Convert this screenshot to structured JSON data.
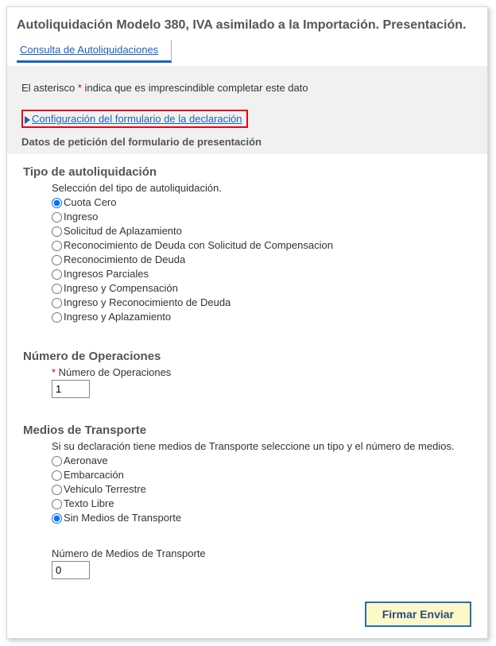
{
  "header": {
    "title": "Autoliquidación Modelo 380, IVA asimilado a la Importación. Presentación."
  },
  "tabs": {
    "consulta": "Consulta de Autoliquidaciones"
  },
  "notes": {
    "required_prefix": "El asterisco ",
    "required_mark": "*",
    "required_suffix": " indica que es imprescindible completar este dato"
  },
  "config_link": "Configuración del formulario de la declaración",
  "section_title": "Datos de petición del formulario de presentación",
  "autoliq": {
    "heading": "Tipo de autoliquidación",
    "helper": "Selección del tipo de autoliquidación.",
    "options": [
      "Cuota Cero",
      "Ingreso",
      "Solicitud de Aplazamiento",
      "Reconocimiento de Deuda con Solicitud de Compensacion",
      "Reconocimiento de Deuda",
      "Ingresos Parciales",
      "Ingreso y Compensación",
      "Ingreso y Reconocimiento de Deuda",
      "Ingreso y Aplazamiento"
    ],
    "selected_index": 0
  },
  "num_ops": {
    "heading": "Número de Operaciones",
    "label": "Número de Operaciones",
    "value": "1"
  },
  "transporte": {
    "heading": "Medios de Transporte",
    "helper": "Si su declaración tiene medios de Transporte seleccione un tipo y el número de medios.",
    "options": [
      "Aeronave",
      "Embarcación",
      "Vehiculo Terrestre",
      "Texto Libre",
      "Sin Medios de Transporte"
    ],
    "selected_index": 4,
    "count_label": "Número de Medios de Transporte",
    "count_value": "0"
  },
  "buttons": {
    "submit": "Firmar Enviar"
  }
}
